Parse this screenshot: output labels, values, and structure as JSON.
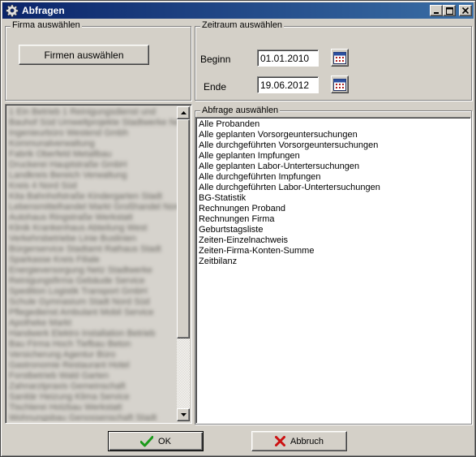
{
  "window": {
    "title": "Abfragen",
    "icons": {
      "app": "gear-icon",
      "minimize": "minimize-icon",
      "maximize": "maximize-icon",
      "close": "close-icon"
    }
  },
  "company_group": {
    "legend": "Firma auswählen",
    "select_button": "Firmen auswählen",
    "company_list": [
      "1 Ein Betrieb 1 Reinigungsdienst und",
      "Bauhof Süd Umweltprojekte Stadtwerke Nord",
      "Ingenieurbüro Westend Gmbh",
      "Kommunalverwaltung",
      "Fabrik Oberfeld Metallbau",
      "Druckerei Hauptstraße GmbH",
      "Landkreis Bereich Verwaltung",
      "Kreis 4 Nord Süd",
      "Kita Bahnhofstraße Kindergarten Stadt",
      "Lebensmittelhandel Markt Großhandel Nord",
      "Autohaus Ringstraße Werkstatt",
      "Klinik Krankenhaus Abteilung West",
      "Verkehrsbetriebe Linie Buslinien",
      "Bürgerservice Stadtamt Rathaus Stadt",
      "Sparkasse Kreis Filiale",
      "Energieversorgung Netz Stadtwerke",
      "Reinigungsfirma Gebäude Service",
      "Spedition Logistik Transport GmbH",
      "Schule Gymnasium Stadt Nord Süd",
      "Pflegedienst Ambulant Mobil Service",
      "Apotheke Markt",
      "Handwerk Elektro Installation Betrieb",
      "Bau Firma Hoch Tiefbau Beton",
      "Versicherung Agentur Büro",
      "Gastronomie Restaurant Hotel",
      "Forstbetrieb Wald Garten",
      "Zahnarztpraxis Gemeinschaft",
      "Sanitär Heizung Klima Service",
      "Tischlerei Holzbau Werkstatt",
      "Wohnungsbau Genossenschaft Stadt"
    ]
  },
  "period_group": {
    "legend": "Zeitraum auswählen",
    "start_label": "Beginn",
    "start_value": "01.01.2010",
    "end_label": "Ende",
    "end_value": "19.06.2012",
    "calendar_icon": "calendar-icon"
  },
  "query_group": {
    "legend": "Abfrage auswählen",
    "items": [
      "Alle Probanden",
      "Alle geplanten Vorsorgeuntersuchungen",
      "Alle durchgeführten Vorsorgeuntersuchungen",
      "Alle geplanten Impfungen",
      "Alle geplanten Labor-Untertersuchungen",
      "Alle durchgeführten Impfungen",
      "Alle durchgeführten Labor-Untertersuchungen",
      "BG-Statistik",
      "Rechnungen Proband",
      "Rechnungen Firma",
      "Geburtstagsliste",
      "Zeiten-Einzelnachweis",
      "Zeiten-Firma-Konten-Summe",
      "Zeitbilanz"
    ]
  },
  "footer": {
    "ok_label": "OK",
    "ok_icon": "checkmark-icon",
    "cancel_label": "Abbruch",
    "cancel_icon": "x-cross-icon",
    "colors": {
      "ok_icon": "#1a9a1a",
      "cancel_icon": "#cc1111"
    }
  }
}
